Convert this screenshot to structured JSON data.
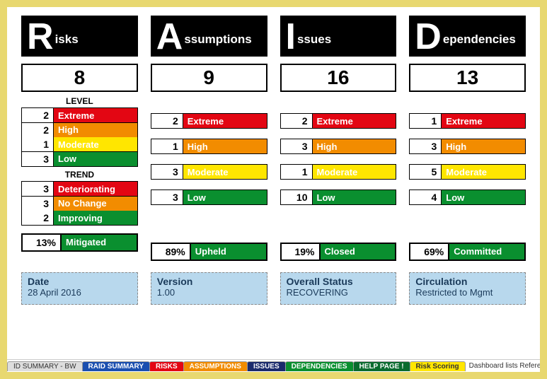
{
  "columns": [
    {
      "letter": "R",
      "rest": "isks",
      "total": "8",
      "levelHeader": "LEVEL",
      "levels": [
        {
          "n": "2",
          "label": "Extreme",
          "cls": "lvl-extreme"
        },
        {
          "n": "2",
          "label": "High",
          "cls": "lvl-high"
        },
        {
          "n": "1",
          "label": "Moderate",
          "cls": "lvl-moderate"
        },
        {
          "n": "3",
          "label": "Low",
          "cls": "lvl-low"
        }
      ],
      "trendHeader": "TREND",
      "trends": [
        {
          "n": "3",
          "label": "Deteriorating",
          "cls": "trend-det"
        },
        {
          "n": "3",
          "label": "No Change",
          "cls": "trend-nc"
        },
        {
          "n": "2",
          "label": "Improving",
          "cls": "trend-imp"
        }
      ],
      "summaryPct": "13%",
      "summaryLabel": "Mitigated"
    },
    {
      "letter": "A",
      "rest": "ssumptions",
      "total": "9",
      "levels": [
        {
          "n": "2",
          "label": "Extreme",
          "cls": "lvl-extreme"
        },
        {
          "n": "1",
          "label": "High",
          "cls": "lvl-high"
        },
        {
          "n": "3",
          "label": "Moderate",
          "cls": "lvl-moderate"
        },
        {
          "n": "3",
          "label": "Low",
          "cls": "lvl-low"
        }
      ],
      "summaryPct": "89%",
      "summaryLabel": "Upheld"
    },
    {
      "letter": "I",
      "rest": "ssues",
      "total": "16",
      "levels": [
        {
          "n": "2",
          "label": "Extreme",
          "cls": "lvl-extreme"
        },
        {
          "n": "3",
          "label": "High",
          "cls": "lvl-high"
        },
        {
          "n": "1",
          "label": "Moderate",
          "cls": "lvl-moderate"
        },
        {
          "n": "10",
          "label": "Low",
          "cls": "lvl-low"
        }
      ],
      "summaryPct": "19%",
      "summaryLabel": "Closed"
    },
    {
      "letter": "D",
      "rest": "ependencies",
      "total": "13",
      "levels": [
        {
          "n": "1",
          "label": "Extreme",
          "cls": "lvl-extreme"
        },
        {
          "n": "3",
          "label": "High",
          "cls": "lvl-high"
        },
        {
          "n": "5",
          "label": "Moderate",
          "cls": "lvl-moderate"
        },
        {
          "n": "4",
          "label": "Low",
          "cls": "lvl-low"
        }
      ],
      "summaryPct": "69%",
      "summaryLabel": "Committed"
    }
  ],
  "info": [
    {
      "title": "Date",
      "value": "28 April 2016"
    },
    {
      "title": "Version",
      "value": "1.00"
    },
    {
      "title": "Overall Status",
      "value": "RECOVERING"
    },
    {
      "title": "Circulation",
      "value": "Restricted to Mgmt"
    }
  ],
  "tabs": [
    {
      "label": "ID SUMMARY - BW",
      "cls": "tab-grey"
    },
    {
      "label": "RAID SUMMARY",
      "cls": "tab-blue"
    },
    {
      "label": "RISKS",
      "cls": "tab-red"
    },
    {
      "label": "ASSUMPTIONS",
      "cls": "tab-orange"
    },
    {
      "label": "ISSUES",
      "cls": "tab-darkblue"
    },
    {
      "label": "DEPENDENCIES",
      "cls": "tab-green"
    },
    {
      "label": "HELP PAGE !",
      "cls": "tab-dgreen"
    },
    {
      "label": "Risk Scoring",
      "cls": "tab-yellow"
    }
  ],
  "tabsRest": "Dashboard lists Referenc"
}
